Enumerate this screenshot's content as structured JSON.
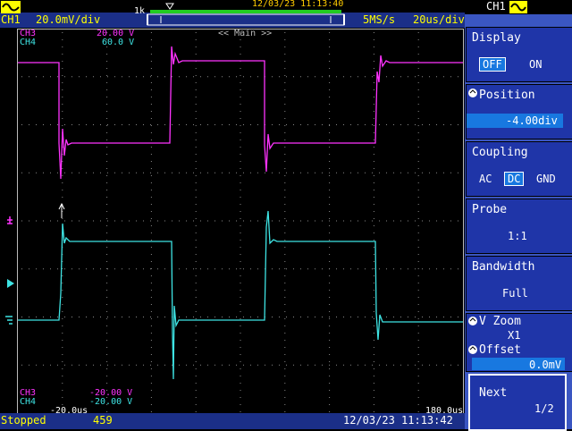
{
  "topbar": {
    "channel": "CH1",
    "volts_div": "20.0mV/div",
    "memory": "1k",
    "timestamp": "12/03/23 11:13:40",
    "sample_rate": "5MS/s",
    "time_div": "20us/div"
  },
  "screen": {
    "label_ch3_top": "CH3",
    "label_ch4_top": "CH4",
    "ch3_scale": "20.00 V",
    "ch4_scale": "60.0 V",
    "main_label": "<< Main >>",
    "label_ch3_bottom": "CH3",
    "label_ch4_bottom": "CH4",
    "ch3_bottom_value": "-20.00 V",
    "ch4_bottom_value": "-20.00 V",
    "time_left": "-20.0us",
    "time_right": "180.0us"
  },
  "menu": {
    "header": "CH1",
    "display_title": "Display",
    "display_off": "OFF",
    "display_on": "ON",
    "position_title": "Position",
    "position_value": "-4.00div",
    "coupling_title": "Coupling",
    "coupling_ac": "AC",
    "coupling_dc": "DC",
    "coupling_gnd": "GND",
    "probe_title": "Probe",
    "probe_value": "1:1",
    "bandwidth_title": "Bandwidth",
    "bandwidth_value": "Full",
    "vzoom_title": "V Zoom",
    "vzoom_value": "X1",
    "offset_title": "Offset",
    "offset_value": "0.0mV",
    "next_title": "Next",
    "next_page": "1/2"
  },
  "status": {
    "state": "Stopped",
    "count": "459",
    "timestamp": "12/03/23 11:13:42"
  },
  "colors": {
    "ch3": "#ff33ff",
    "ch4": "#3ee4e4",
    "ch1": "#ffff00",
    "menu_bg": "#3a56c2"
  }
}
